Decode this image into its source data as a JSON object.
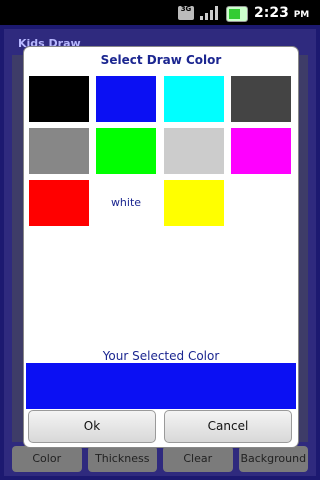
{
  "status_bar": {
    "network": "3G",
    "time": "2:23",
    "ampm": "PM"
  },
  "app": {
    "title": "Kids Draw",
    "bottom_buttons": [
      "Color",
      "Thickness",
      "Clear",
      "Background"
    ]
  },
  "dialog": {
    "title": "Select Draw Color",
    "swatches": [
      {
        "name": "black",
        "color": "#000000",
        "label": ""
      },
      {
        "name": "blue",
        "color": "#0b10f3",
        "label": ""
      },
      {
        "name": "cyan",
        "color": "#00ffff",
        "label": ""
      },
      {
        "name": "dark-gray",
        "color": "#444444",
        "label": ""
      },
      {
        "name": "gray",
        "color": "#878787",
        "label": ""
      },
      {
        "name": "green",
        "color": "#00ff00",
        "label": ""
      },
      {
        "name": "light-gray",
        "color": "#cccccc",
        "label": ""
      },
      {
        "name": "magenta",
        "color": "#ff00ff",
        "label": ""
      },
      {
        "name": "red",
        "color": "#ff0000",
        "label": ""
      },
      {
        "name": "white",
        "color": "#ffffff",
        "label": "white"
      },
      {
        "name": "yellow",
        "color": "#ffff00",
        "label": ""
      }
    ],
    "selected_label": "Your Selected Color",
    "selected_color": "#0b10f3",
    "ok_label": "Ok",
    "cancel_label": "Cancel"
  }
}
